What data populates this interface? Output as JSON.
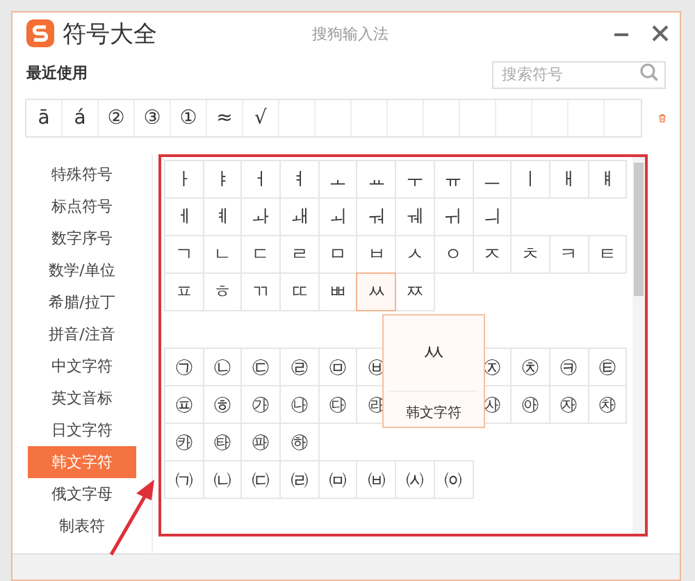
{
  "window": {
    "title": "符号大全",
    "app_name": "搜狗输入法"
  },
  "recent": {
    "label": "最近使用",
    "symbols": [
      "ā",
      "á",
      "②",
      "③",
      "①",
      "≈",
      "√"
    ]
  },
  "search": {
    "placeholder": "搜索符号"
  },
  "sidebar": {
    "items": [
      {
        "label": "特殊符号",
        "selected": false
      },
      {
        "label": "标点符号",
        "selected": false
      },
      {
        "label": "数字序号",
        "selected": false
      },
      {
        "label": "数学/单位",
        "selected": false
      },
      {
        "label": "希腊/拉丁",
        "selected": false
      },
      {
        "label": "拼音/注音",
        "selected": false
      },
      {
        "label": "中文字符",
        "selected": false
      },
      {
        "label": "英文音标",
        "selected": false
      },
      {
        "label": "日文字符",
        "selected": false
      },
      {
        "label": "韩文字符",
        "selected": true
      },
      {
        "label": "俄文字母",
        "selected": false
      },
      {
        "label": "制表符",
        "selected": false
      }
    ]
  },
  "grid": {
    "sections": [
      {
        "rows": [
          [
            {
              "symbol": "ㅏ"
            },
            {
              "symbol": "ㅑ"
            },
            {
              "symbol": "ㅓ"
            },
            {
              "symbol": "ㅕ"
            },
            {
              "symbol": "ㅗ"
            },
            {
              "symbol": "ㅛ"
            },
            {
              "symbol": "ㅜ"
            },
            {
              "symbol": "ㅠ"
            },
            {
              "symbol": "ㅡ"
            },
            {
              "symbol": "ㅣ"
            },
            {
              "symbol": "ㅐ"
            },
            {
              "symbol": "ㅒ"
            }
          ],
          [
            {
              "symbol": "ㅔ"
            },
            {
              "symbol": "ㅖ"
            },
            {
              "symbol": "ㅘ"
            },
            {
              "symbol": "ㅙ"
            },
            {
              "symbol": "ㅚ"
            },
            {
              "symbol": "ㅝ"
            },
            {
              "symbol": "ㅞ"
            },
            {
              "symbol": "ㅟ"
            },
            {
              "symbol": "ㅢ"
            }
          ],
          [
            {
              "symbol": "ㄱ"
            },
            {
              "symbol": "ㄴ"
            },
            {
              "symbol": "ㄷ"
            },
            {
              "symbol": "ㄹ"
            },
            {
              "symbol": "ㅁ"
            },
            {
              "symbol": "ㅂ"
            },
            {
              "symbol": "ㅅ"
            },
            {
              "symbol": "ㅇ"
            },
            {
              "symbol": "ㅈ"
            },
            {
              "symbol": "ㅊ"
            },
            {
              "symbol": "ㅋ"
            },
            {
              "symbol": "ㅌ"
            }
          ],
          [
            {
              "symbol": "ㅍ"
            },
            {
              "symbol": "ㅎ"
            },
            {
              "symbol": "ㄲ"
            },
            {
              "symbol": "ㄸ"
            },
            {
              "symbol": "ㅃ"
            },
            {
              "symbol": "ㅆ",
              "hovered": true
            },
            {
              "symbol": "ㅉ"
            }
          ]
        ]
      },
      {
        "rows": [
          [
            {
              "symbol": "㉠"
            },
            {
              "symbol": "㉡"
            },
            {
              "symbol": "㉢"
            },
            {
              "symbol": "㉣"
            },
            {
              "symbol": "㉤"
            },
            {
              "symbol": "㉥"
            },
            {},
            {},
            {
              "symbol": "㉨"
            },
            {
              "symbol": "㉩"
            },
            {
              "symbol": "㉪"
            },
            {
              "symbol": "㉫"
            }
          ],
          [
            {
              "symbol": "㉬"
            },
            {
              "symbol": "㉭"
            },
            {
              "symbol": "㉮"
            },
            {
              "symbol": "㉯"
            },
            {
              "symbol": "㉰"
            },
            {
              "symbol": "㉱"
            },
            {},
            {},
            {
              "symbol": "㉴"
            },
            {
              "symbol": "㉵"
            },
            {
              "symbol": "㉶"
            },
            {
              "symbol": "㉷"
            }
          ],
          [
            {
              "symbol": "㉸"
            },
            {
              "symbol": "㉹"
            },
            {
              "symbol": "㉺"
            },
            {
              "symbol": "㉻"
            }
          ],
          [
            {
              "symbol": "㈀"
            },
            {
              "symbol": "㈁"
            },
            {
              "symbol": "㈂"
            },
            {
              "symbol": "㈃"
            },
            {
              "symbol": "㈄"
            },
            {
              "symbol": "㈅"
            },
            {
              "symbol": "㈆"
            },
            {
              "symbol": "㈇"
            }
          ]
        ]
      }
    ]
  },
  "preview": {
    "symbol": "ㅆ",
    "category": "韩文字符"
  }
}
